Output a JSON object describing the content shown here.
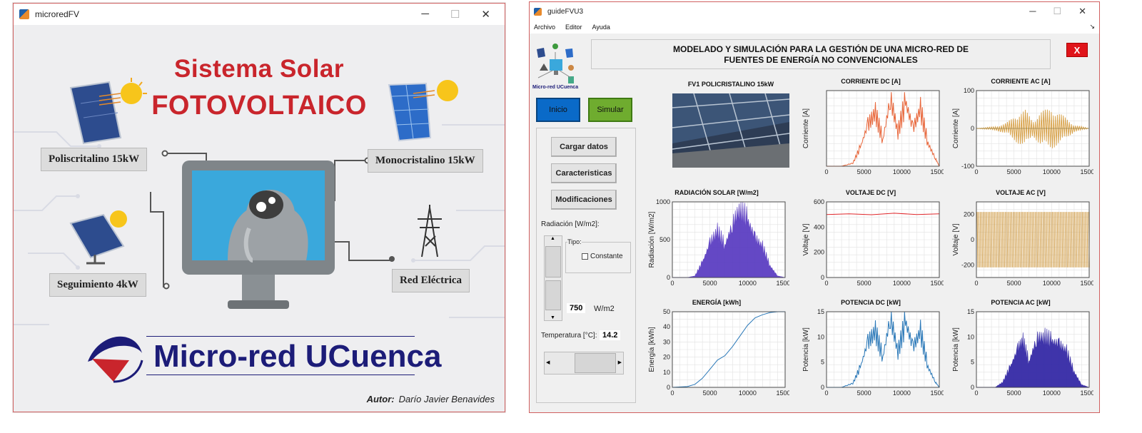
{
  "window1": {
    "title": "microredFV",
    "controls": [
      "─",
      "☐",
      "✕"
    ],
    "heading_line1": "Sistema Solar",
    "heading_line2": "FOTOVOLTAICO",
    "labels": {
      "poly": "Poliscritalino 15kW",
      "mono": "Monocristalino 15kW",
      "tracking": "Seguimiento 4kW",
      "grid": "Red Eléctrica"
    },
    "brand": "Micro-red UCuenca",
    "author_label": "Autor:",
    "author_name": "Darío Javier Benavides",
    "colors": {
      "title_red": "#c9252c",
      "brand_blue": "#1c1c78"
    }
  },
  "window2": {
    "title": "guideFVU3",
    "controls": [
      "─",
      "☐",
      "✕"
    ],
    "menu": [
      "Archivo",
      "Editor",
      "Ayuda"
    ],
    "menu_dock": "↘",
    "header_line1": "MODELADO Y SIMULACIÓN PARA LA GESTIÓN DE UNA MICRO-RED DE",
    "header_line2": "FUENTES DE ENERGÍA NO CONVENCIONALES",
    "close_label": "X",
    "logo_caption": "Micro-red UCuenca",
    "buttons": {
      "inicio": "Inicio",
      "simular": "Simular",
      "cargar": "Cargar datos",
      "caracteristicas": "Caracteristicas",
      "modificaciones": "Modificaciones"
    },
    "radiacion_label": "Radiación [W/m2]:",
    "tipo_label": "Tipo:",
    "constante_label": "Constante",
    "radiacion_value": "750",
    "radiacion_unit": "W/m2",
    "temperatura_label": "Temperatura [°C]:",
    "temperatura_value": "14.2",
    "photo_title": "FV1 POLICRISTALINO 15kW"
  },
  "chart_data": [
    {
      "id": "corriente_dc",
      "type": "line",
      "title": "CORRIENTE DC [A]",
      "ylabel": "Corriente [A]",
      "xlim": [
        0,
        15000
      ],
      "xticks": [
        "0",
        "5000",
        "10000",
        "15000"
      ],
      "yticks": [],
      "ylim": [
        0,
        1
      ],
      "color": "#e8663a",
      "x": [
        0,
        2000,
        3500,
        4500,
        5500,
        6500,
        7500,
        8500,
        9500,
        10500,
        11500,
        12500,
        13500,
        14500,
        15000
      ],
      "values": [
        0.0,
        0.0,
        0.04,
        0.25,
        0.55,
        0.7,
        0.35,
        0.9,
        0.45,
        0.85,
        0.5,
        0.75,
        0.3,
        0.1,
        0.0
      ],
      "grid": true
    },
    {
      "id": "corriente_ac",
      "type": "line",
      "title": "CORRIENTE AC [A]",
      "ylabel": "Corriente [A]",
      "xlim": [
        0,
        15000
      ],
      "xticks": [
        "0",
        "5000",
        "10000",
        "15000"
      ],
      "yticks": [
        "100",
        "0",
        "-100"
      ],
      "ylim": [
        -100,
        100
      ],
      "color": "#d7a046",
      "x": [
        0,
        2500,
        4000,
        5500,
        6500,
        7500,
        8500,
        10000,
        11500,
        13000,
        15000
      ],
      "values": [
        0,
        5,
        15,
        40,
        50,
        20,
        45,
        55,
        35,
        10,
        0
      ],
      "grid": true,
      "style": "oscillation"
    },
    {
      "id": "radiacion",
      "type": "area",
      "title": "RADIACIÓN SOLAR [W/m2]",
      "ylabel": "Radiación [W/m2]",
      "xlim": [
        0,
        15000
      ],
      "xticks": [
        "0",
        "5000",
        "10000",
        "15000"
      ],
      "yticks": [
        "1000",
        "500",
        "0"
      ],
      "ylim": [
        0,
        1000
      ],
      "color": "#5c3fc2",
      "x": [
        0,
        2000,
        3000,
        4000,
        5000,
        6000,
        7000,
        8000,
        9000,
        10000,
        11000,
        12000,
        13000,
        14000,
        15000
      ],
      "values": [
        0,
        0,
        20,
        200,
        450,
        600,
        420,
        700,
        900,
        750,
        520,
        400,
        150,
        20,
        0
      ],
      "grid": true
    },
    {
      "id": "voltaje_dc",
      "type": "line",
      "title": "VOLTAJE DC [V]",
      "ylabel": "Voltaje [V]",
      "xlim": [
        0,
        15000
      ],
      "xticks": [
        "0",
        "5000",
        "10000",
        "15000"
      ],
      "yticks": [
        "600",
        "400",
        "200",
        "0"
      ],
      "ylim": [
        0,
        600
      ],
      "color": "#e0262a",
      "x": [
        0,
        3000,
        6000,
        9000,
        12000,
        15000
      ],
      "values": [
        500,
        505,
        498,
        510,
        500,
        505
      ],
      "grid": true
    },
    {
      "id": "voltaje_ac",
      "type": "line",
      "title": "VOLTAJE AC [V]",
      "ylabel": "Voltaje [V]",
      "xlim": [
        0,
        15000
      ],
      "xticks": [
        "0",
        "5000",
        "10000",
        "15000"
      ],
      "yticks": [
        "200",
        "0",
        "-200"
      ],
      "ylim": [
        -300,
        300
      ],
      "color": "#cf9a42",
      "x": [
        0,
        15000
      ],
      "values": [
        220,
        220
      ],
      "grid": true,
      "style": "band"
    },
    {
      "id": "energia",
      "type": "line",
      "title": "ENERGÍA [kWh]",
      "ylabel": "Energía [kWh]",
      "xlim": [
        0,
        15000
      ],
      "xticks": [
        "0",
        "5000",
        "10000",
        "15000"
      ],
      "yticks": [
        "50",
        "40",
        "30",
        "20",
        "10",
        "0"
      ],
      "ylim": [
        0,
        50
      ],
      "color": "#2a78b8",
      "x": [
        0,
        2000,
        3000,
        4000,
        5000,
        6000,
        7000,
        8000,
        9000,
        10000,
        11000,
        12000,
        13000,
        14000,
        15000
      ],
      "values": [
        0,
        0.5,
        2,
        6,
        12,
        18,
        21,
        27,
        34,
        41,
        46,
        48,
        49.5,
        50,
        50
      ],
      "grid": true
    },
    {
      "id": "potencia_dc",
      "type": "line",
      "title": "POTENCIA DC [kW]",
      "ylabel": "Potencia [kW]",
      "xlim": [
        0,
        15000
      ],
      "xticks": [
        "0",
        "5000",
        "10000",
        "15000"
      ],
      "yticks": [
        "15",
        "10",
        "5",
        "0"
      ],
      "ylim": [
        0,
        15
      ],
      "color": "#2a78b8",
      "x": [
        0,
        2000,
        3500,
        4500,
        5500,
        6500,
        7500,
        8500,
        9500,
        10500,
        11500,
        12500,
        13500,
        14500,
        15000
      ],
      "values": [
        0,
        0,
        0.8,
        4,
        9,
        11,
        6,
        14,
        7,
        13,
        8,
        11,
        4,
        1,
        0
      ],
      "grid": true
    },
    {
      "id": "potencia_ac",
      "type": "area",
      "title": "POTENCIA AC [kW]",
      "ylabel": "Potencia [kW]",
      "xlim": [
        0,
        15000
      ],
      "xticks": [
        "0",
        "5000",
        "10000",
        "15000"
      ],
      "yticks": [
        "15",
        "10",
        "5",
        "0"
      ],
      "ylim": [
        0,
        15
      ],
      "color": "#352aa6",
      "x": [
        0,
        2500,
        3500,
        4500,
        5500,
        6200,
        7000,
        8000,
        9000,
        10000,
        11000,
        12000,
        13000,
        14000,
        15000
      ],
      "values": [
        0,
        0,
        1,
        4,
        7.5,
        9,
        5,
        9.5,
        9.8,
        9,
        8.5,
        7,
        3,
        0.5,
        0
      ],
      "grid": true
    }
  ]
}
